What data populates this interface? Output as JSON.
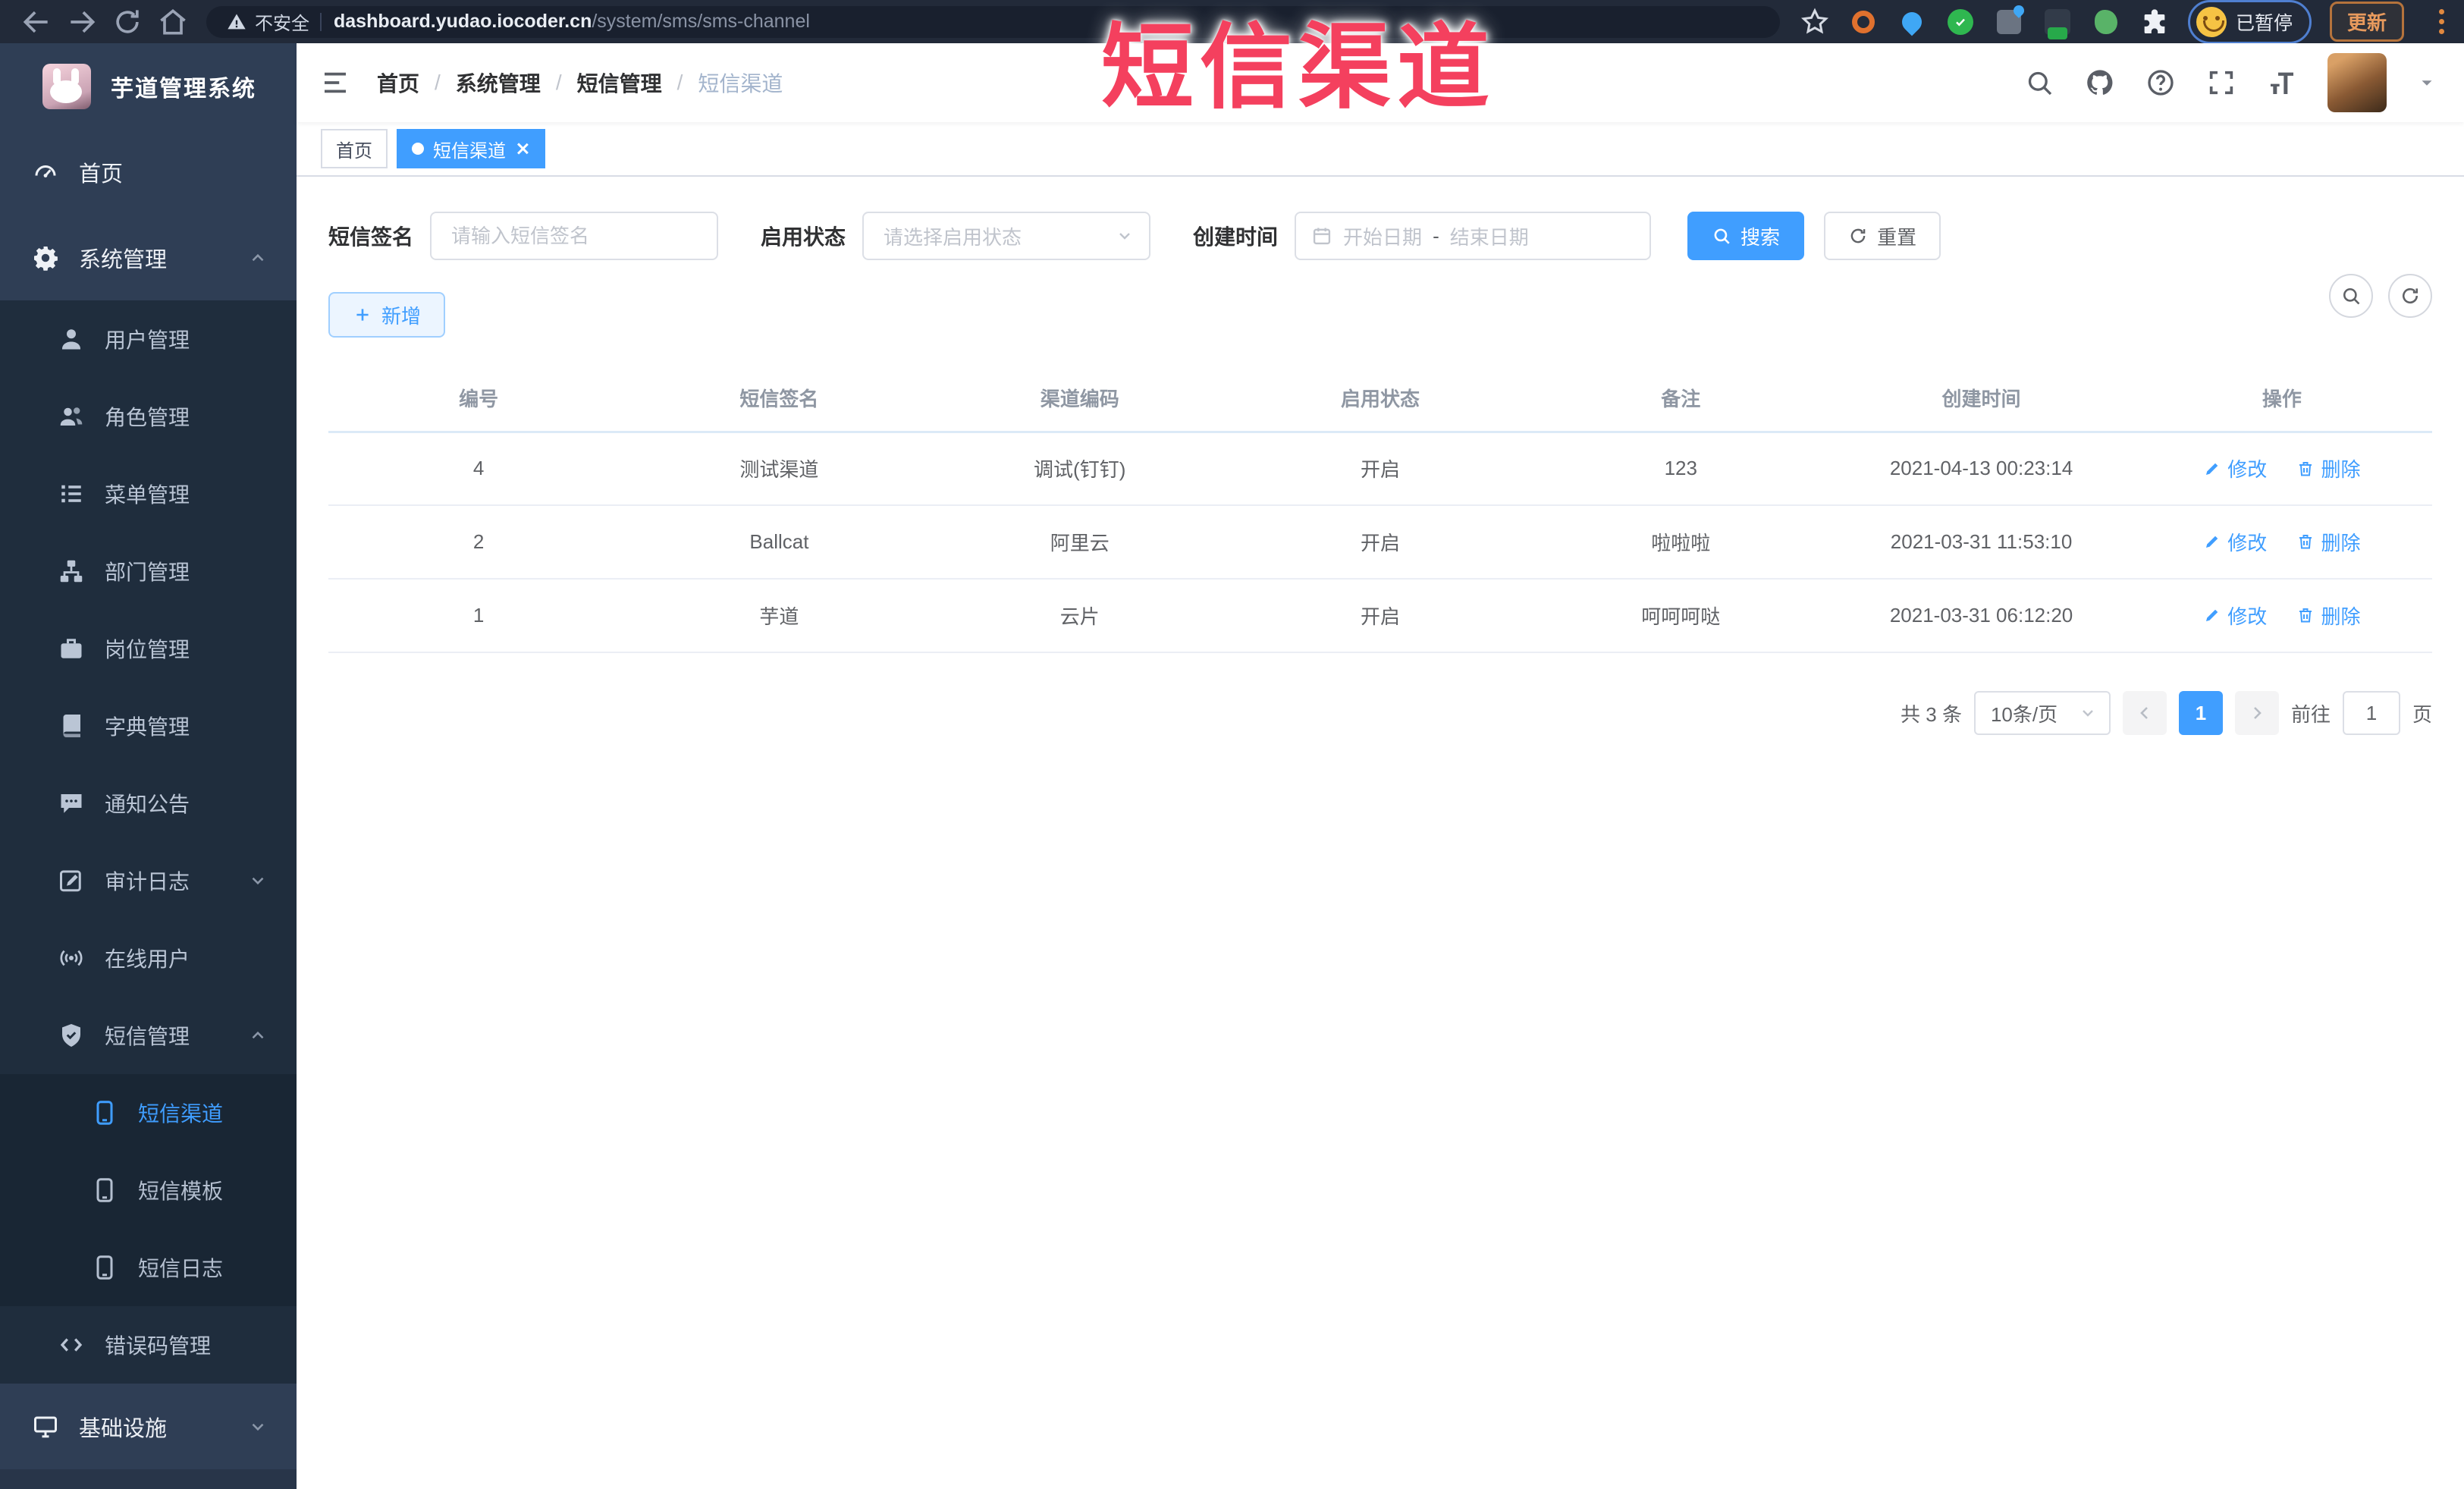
{
  "browser": {
    "security_label": "不安全",
    "url_domain": "dashboard.yudao.iocoder.cn",
    "url_path": "/system/sms/sms-channel",
    "paused_label": "已暂停",
    "update_label": "更新"
  },
  "watermark": "短信渠道",
  "sidebar": {
    "app_title": "芋道管理系统",
    "items": [
      {
        "label": "首页",
        "icon": "gauge-icon",
        "level": 1
      },
      {
        "label": "系统管理",
        "icon": "gear-icon",
        "level": 1,
        "state": "expanded"
      },
      {
        "label": "用户管理",
        "icon": "user-icon",
        "level": 2
      },
      {
        "label": "角色管理",
        "icon": "role-users-icon",
        "level": 2
      },
      {
        "label": "菜单管理",
        "icon": "menu-list-icon",
        "level": 2
      },
      {
        "label": "部门管理",
        "icon": "org-tree-icon",
        "level": 2
      },
      {
        "label": "岗位管理",
        "icon": "post-badge-icon",
        "level": 2
      },
      {
        "label": "字典管理",
        "icon": "dict-book-icon",
        "level": 2
      },
      {
        "label": "通知公告",
        "icon": "notice-bubble-icon",
        "level": 2
      },
      {
        "label": "审计日志",
        "icon": "audit-log-icon",
        "level": 2,
        "state": "collapsed"
      },
      {
        "label": "在线用户",
        "icon": "online-signal-icon",
        "level": 2
      },
      {
        "label": "短信管理",
        "icon": "sms-shield-icon",
        "level": 2,
        "state": "expanded"
      },
      {
        "label": "短信渠道",
        "icon": "phone-icon",
        "level": 3,
        "state": "active"
      },
      {
        "label": "短信模板",
        "icon": "phone-icon",
        "level": 3
      },
      {
        "label": "短信日志",
        "icon": "phone-icon",
        "level": 3
      },
      {
        "label": "错误码管理",
        "icon": "code-icon",
        "level": 2
      },
      {
        "label": "基础设施",
        "icon": "monitor-icon",
        "level": 1,
        "state": "collapsed"
      }
    ]
  },
  "header": {
    "breadcrumb": [
      "首页",
      "系统管理",
      "短信管理",
      "短信渠道"
    ]
  },
  "tabs": [
    {
      "label": "首页",
      "active": false
    },
    {
      "label": "短信渠道",
      "active": true
    }
  ],
  "filters": {
    "signature_label": "短信签名",
    "signature_placeholder": "请输入短信签名",
    "status_label": "启用状态",
    "status_placeholder": "请选择启用状态",
    "time_label": "创建时间",
    "start_placeholder": "开始日期",
    "range_separator": "-",
    "end_placeholder": "结束日期",
    "search_button": "搜索",
    "reset_button": "重置"
  },
  "toolbar": {
    "add_button": "新增"
  },
  "table": {
    "columns": [
      "编号",
      "短信签名",
      "渠道编码",
      "启用状态",
      "备注",
      "创建时间",
      "操作"
    ],
    "rows": [
      {
        "id": "4",
        "signature": "测试渠道",
        "code": "调试(钉钉)",
        "status": "开启",
        "remark": "123",
        "created": "2021-04-13 00:23:14",
        "edit": "修改",
        "delete": "删除"
      },
      {
        "id": "2",
        "signature": "Ballcat",
        "code": "阿里云",
        "status": "开启",
        "remark": "啦啦啦",
        "created": "2021-03-31 11:53:10",
        "edit": "修改",
        "delete": "删除"
      },
      {
        "id": "1",
        "signature": "芋道",
        "code": "云片",
        "status": "开启",
        "remark": "呵呵呵哒",
        "created": "2021-03-31 06:12:20",
        "edit": "修改",
        "delete": "删除"
      }
    ]
  },
  "pagination": {
    "total_label": "共 3 条",
    "page_size": "10条/页",
    "current_page": "1",
    "goto_label": "前往",
    "goto_value": "1",
    "unit_label": "页"
  },
  "colors": {
    "accent": "#409eff",
    "watermark_red": "#f4405e",
    "topbar_bg": "#222a39",
    "sidebar_bg": "#2f3e55",
    "submenu_bg": "#1f2d3d",
    "update_orange": "#e0883f"
  }
}
